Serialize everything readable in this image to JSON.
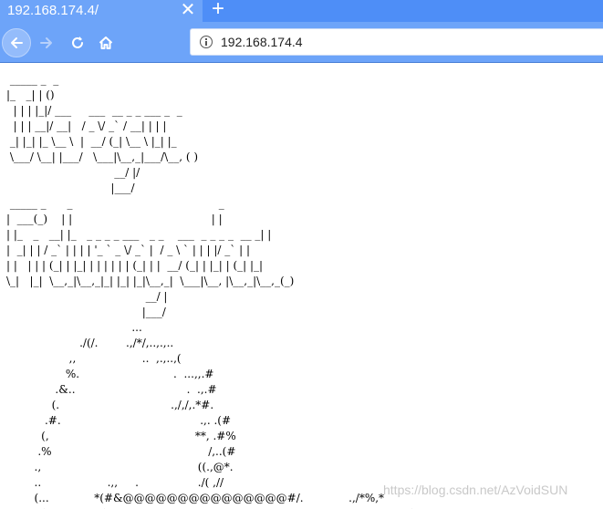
{
  "tab": {
    "title": "192.168.174.4/",
    "close": "✕"
  },
  "newtab": {
    "label": "+"
  },
  "address": {
    "url": "192.168.174.4"
  },
  "colors": {
    "chrome": "#4e8ef7",
    "toolbar": "#6da4f9"
  },
  "icons": [
    "back-arrow-icon",
    "forward-arrow-icon",
    "reload-icon",
    "home-icon",
    "info-icon"
  ],
  "ascii_lines": [
    " _____ _  _",
    "|_   _| | ()",
    "  | | | |_|/ ___     ___  __ _ _ ___ _  _",
    "  | | | __|/ __|   / _ \\/ _` / __| | | |",
    " _| |_| |_ \\__ \\  |  __/ (_| \\__ \\ |_| |_",
    " \\___/ \\__| |___/   \\___|\\__,_|___/\\__, ( )",
    "                               __/ |/",
    "                              |___/",
    " _____ _      _                                          _",
    "|  ___(_)    | |                                        | |",
    "| |_   _   __| |_   _ _ _ _ ___   _ _    ___  _ _ _ _  __ _| |",
    "|  _| | | / _` | | | | '_ ` _ \\/ _` |  / _ \\ ` | | | |/ _` | |",
    "| |   | | | (_| | |_| | | | | | | (_| | |  __/ (_| | |_| | (_| |_|",
    "\\_|   |_|  \\__,_|\\__,_|_| |_| |_|\\__,_|  \\___|\\__, |\\__,_|\\__,_(_)",
    "                                        __/ |",
    "                                       |___/",
    "                                    ...",
    "                     ./(/.        .,/*/,..,.,..",
    "                  ,,                   ..  ,.,..,(",
    "                 %.                           .  ...,,.#",
    "              .&..                                .  .,.#",
    "             (.                                .,/,/,.*#.",
    "           .#.                                        .,. .(#",
    "          (,                                          **, .#%",
    "         .%                                             /,..(#",
    "        .,                                             ((.,@*.",
    "        ..                   .,,     .                 ./( ,//",
    "        (...             *(#&@@@@@@@@@@@@@@@#/.             .,/*%,*",
    "       %(                (@@@@#     ./  %@@@@@@@@@@@@@/ *    *    .*@("
  ],
  "watermark": "https://blog.csdn.net/AzVoidSUN"
}
